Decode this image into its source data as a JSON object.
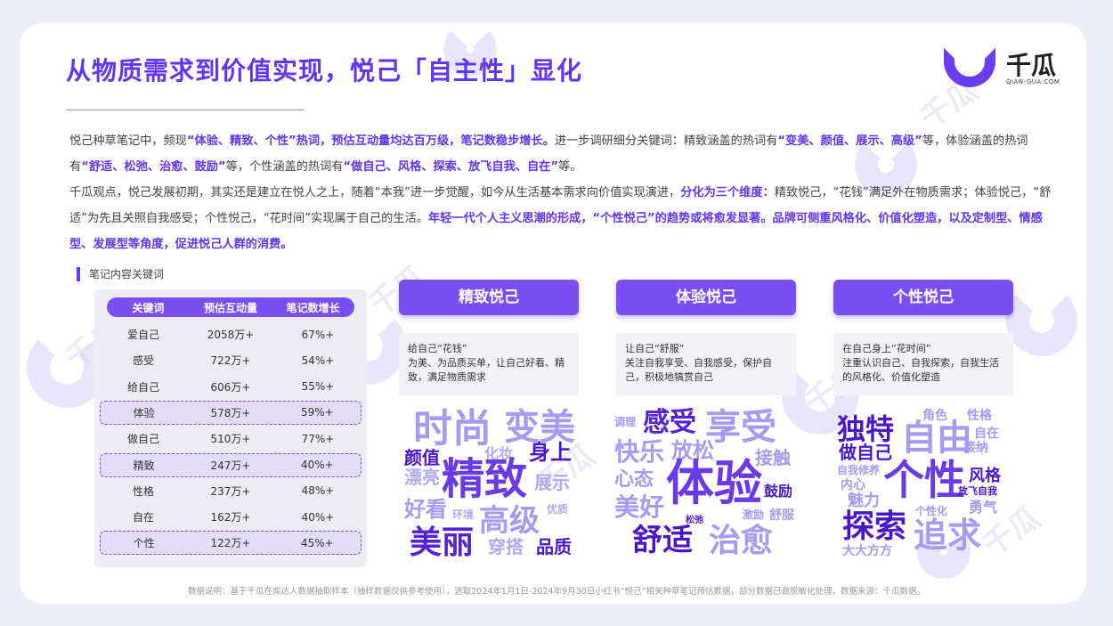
{
  "header": {
    "title": "从物质需求到价值实现，悦己「自主性」显化",
    "logo_text": "千瓜",
    "logo_sub": "QIAN-GUA.COM"
  },
  "intro": {
    "p1": [
      {
        "t": "悦己种草笔记中，频现",
        "b": false
      },
      {
        "t": "“体验、精致、个性”热词，预估互动量均达百万级，笔记数稳步增长。",
        "b": true
      },
      {
        "t": "进一步调研细分关键词：精致涵盖的热词有",
        "b": false
      },
      {
        "t": "“变美、颜值、展示、高级”",
        "b": true
      },
      {
        "t": "等，体验涵盖的热词有",
        "b": false
      },
      {
        "t": "“舒适、松弛、治愈、鼓励”",
        "b": true
      },
      {
        "t": "等，个性涵盖的热词有",
        "b": false
      },
      {
        "t": "“做自己、风格、探索、放飞自我、自在”",
        "b": true
      },
      {
        "t": "等。",
        "b": false
      }
    ],
    "p2": [
      {
        "t": "千瓜观点，悦己发展初期，其实还是建立在悦人之上，随着“本我”进一步觉醒，如今从生活基本需求向价值实现演进，",
        "b": false
      },
      {
        "t": "分化为三个维度：",
        "b": true
      },
      {
        "t": "精致悦己，“花钱”满足外在物质需求；体验悦己，“舒适”为先且关照自我感受；个性悦己，“花时间”实现属于自己的生活。",
        "b": false
      },
      {
        "t": "年轻一代个人主义思潮的形成，“个性悦己”的趋势或将愈发显著。品牌可侧重风格化、价值化塑造，以及定制型、情感型、发展型等角度，促进悦己人群的消费。",
        "b": true
      }
    ]
  },
  "table": {
    "section_label": "笔记内容关键词",
    "headers": [
      "关键词",
      "预估互动量",
      "笔记数增长"
    ],
    "rows": [
      {
        "keyword": "爱自己",
        "interaction": "2058万+",
        "growth": "67%+",
        "highlight": false
      },
      {
        "keyword": "感受",
        "interaction": "722万+",
        "growth": "54%+",
        "highlight": false
      },
      {
        "keyword": "给自己",
        "interaction": "606万+",
        "growth": "55%+",
        "highlight": false
      },
      {
        "keyword": "体验",
        "interaction": "578万+",
        "growth": "59%+",
        "highlight": true
      },
      {
        "keyword": "做自己",
        "interaction": "510万+",
        "growth": "77%+",
        "highlight": false
      },
      {
        "keyword": "精致",
        "interaction": "247万+",
        "growth": "40%+",
        "highlight": true
      },
      {
        "keyword": "性格",
        "interaction": "237万+",
        "growth": "48%+",
        "highlight": false
      },
      {
        "keyword": "自在",
        "interaction": "162万+",
        "growth": "40%+",
        "highlight": false
      },
      {
        "keyword": "个性",
        "interaction": "122万+",
        "growth": "45%+",
        "highlight": true
      }
    ]
  },
  "categories": [
    {
      "label": "精致悦己",
      "desc": [
        "给自己“花钱”",
        "为美、为品质买单，让自己好看、精致，满足物质需求"
      ],
      "words": [
        {
          "w": "时尚",
          "c": "#a79af0"
        },
        {
          "w": "变美",
          "c": "#a79af0"
        },
        {
          "w": "颜值",
          "c": "#4a17c7"
        },
        {
          "w": "化妆",
          "c": "#b2aaf0"
        },
        {
          "w": "身上",
          "c": "#4a17c7"
        },
        {
          "w": "漂亮",
          "c": "#b2aaf0"
        },
        {
          "w": "精致",
          "c": "#6a3ae6"
        },
        {
          "w": "展示",
          "c": "#b2aaf0"
        },
        {
          "w": "好看",
          "c": "#a79af0"
        },
        {
          "w": "环境",
          "c": "#b2aaf0"
        },
        {
          "w": "高级",
          "c": "#a79af0"
        },
        {
          "w": "优质",
          "c": "#b2aaf0"
        },
        {
          "w": "美丽",
          "c": "#5522d6"
        },
        {
          "w": "穿搭",
          "c": "#b2aaf0"
        },
        {
          "w": "品质",
          "c": "#4a17c7"
        }
      ]
    },
    {
      "label": "体验悦己",
      "desc": [
        "让自己“舒服”",
        "关注自我享受、自我感受，保护自己，积极地犒赏自己"
      ],
      "words": [
        {
          "w": "调理",
          "c": "#a79af0"
        },
        {
          "w": "感受",
          "c": "#5522d6"
        },
        {
          "w": "享受",
          "c": "#a79af0"
        },
        {
          "w": "快乐",
          "c": "#a79af0"
        },
        {
          "w": "放松",
          "c": "#a79af0"
        },
        {
          "w": "接触",
          "c": "#a79af0"
        },
        {
          "w": "心态",
          "c": "#a79af0"
        },
        {
          "w": "体验",
          "c": "#6a3ae6"
        },
        {
          "w": "鼓励",
          "c": "#4a17c7"
        },
        {
          "w": "美好",
          "c": "#a79af0"
        },
        {
          "w": "松弛",
          "c": "#4a17c7"
        },
        {
          "w": "激励",
          "c": "#a79af0"
        },
        {
          "w": "舒服",
          "c": "#a79af0"
        },
        {
          "w": "舒适",
          "c": "#4a17c7"
        },
        {
          "w": "治愈",
          "c": "#a79af0"
        }
      ]
    },
    {
      "label": "个性悦己",
      "desc": [
        "在自己身上“花时间”",
        "注重认识自己、自我探索，自我生活的风格化、价值化塑造"
      ],
      "words": [
        {
          "w": "角色",
          "c": "#a79af0"
        },
        {
          "w": "性格",
          "c": "#a79af0"
        },
        {
          "w": "独特",
          "c": "#4a17c7"
        },
        {
          "w": "自由",
          "c": "#a79af0"
        },
        {
          "w": "自在",
          "c": "#a79af0"
        },
        {
          "w": "做自己",
          "c": "#4a17c7"
        },
        {
          "w": "接纳",
          "c": "#a79af0"
        },
        {
          "w": "自我修养",
          "c": "#a79af0"
        },
        {
          "w": "个性",
          "c": "#6a3ae6"
        },
        {
          "w": "风格",
          "c": "#4a17c7"
        },
        {
          "w": "内心",
          "c": "#a79af0"
        },
        {
          "w": "放飞自我",
          "c": "#4a17c7"
        },
        {
          "w": "魅力",
          "c": "#a79af0"
        },
        {
          "w": "勇气",
          "c": "#a79af0"
        },
        {
          "w": "个性化",
          "c": "#a79af0"
        },
        {
          "w": "探索",
          "c": "#4a17c7"
        },
        {
          "w": "追求",
          "c": "#a79af0"
        },
        {
          "w": "大大方方",
          "c": "#a79af0"
        }
      ]
    }
  ],
  "footnote": "数据说明：基于千瓜在库达人数据抽取样本（抽样数据仅供参考使用），选取2024年1月1日-2024年9月30日小红书“悦己”相关种草笔记预估数据，部分数据已做脱敏化处理，数据来源：千瓜数据。"
}
